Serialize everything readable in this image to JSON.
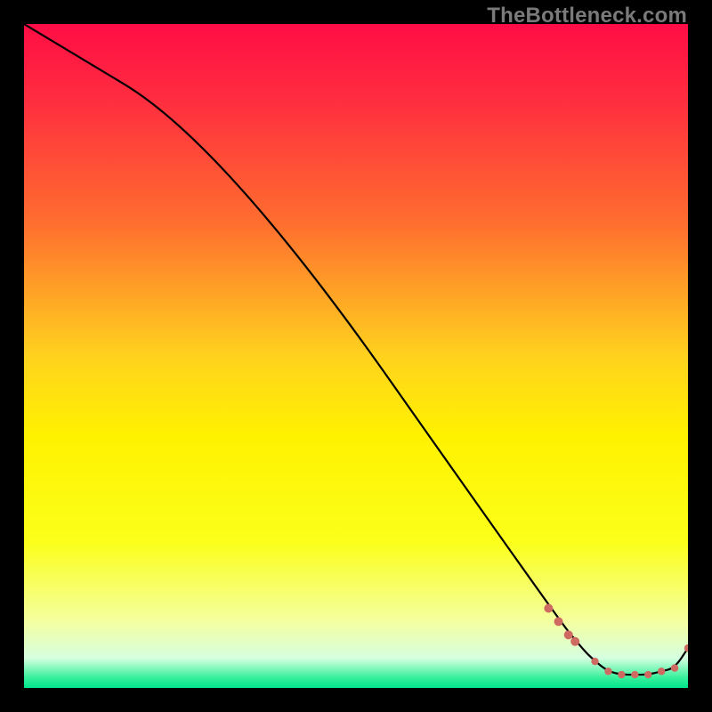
{
  "watermark": "TheBottleneck.com",
  "chart_data": {
    "type": "line",
    "xlim": [
      0,
      100
    ],
    "ylim": [
      0,
      100
    ],
    "title": "",
    "xlabel": "",
    "ylabel": "",
    "series": [
      {
        "name": "curve",
        "x": [
          0,
          30,
          80,
          84,
          86,
          88,
          90,
          92,
          94,
          96,
          98,
          100
        ],
        "y": [
          100,
          82,
          11,
          6,
          4,
          2.5,
          2,
          2,
          2,
          2.5,
          3,
          6
        ]
      }
    ],
    "markers": {
      "name": "points",
      "x": [
        79,
        80.5,
        82,
        83,
        86,
        88,
        90,
        92,
        94,
        96,
        98,
        100
      ],
      "y": [
        12,
        10,
        8,
        7,
        4,
        2.5,
        2,
        2,
        2,
        2.5,
        3,
        6
      ]
    },
    "gradient_stops": [
      {
        "pos": 0.0,
        "color": "#ff0d45"
      },
      {
        "pos": 0.12,
        "color": "#ff2f3f"
      },
      {
        "pos": 0.3,
        "color": "#ff6e2f"
      },
      {
        "pos": 0.5,
        "color": "#ffd21e"
      },
      {
        "pos": 0.62,
        "color": "#fff200"
      },
      {
        "pos": 0.78,
        "color": "#fbff1a"
      },
      {
        "pos": 0.9,
        "color": "#f4ffa0"
      },
      {
        "pos": 0.955,
        "color": "#d6ffe0"
      },
      {
        "pos": 0.985,
        "color": "#35f09a"
      },
      {
        "pos": 1.0,
        "color": "#00e58c"
      }
    ]
  }
}
